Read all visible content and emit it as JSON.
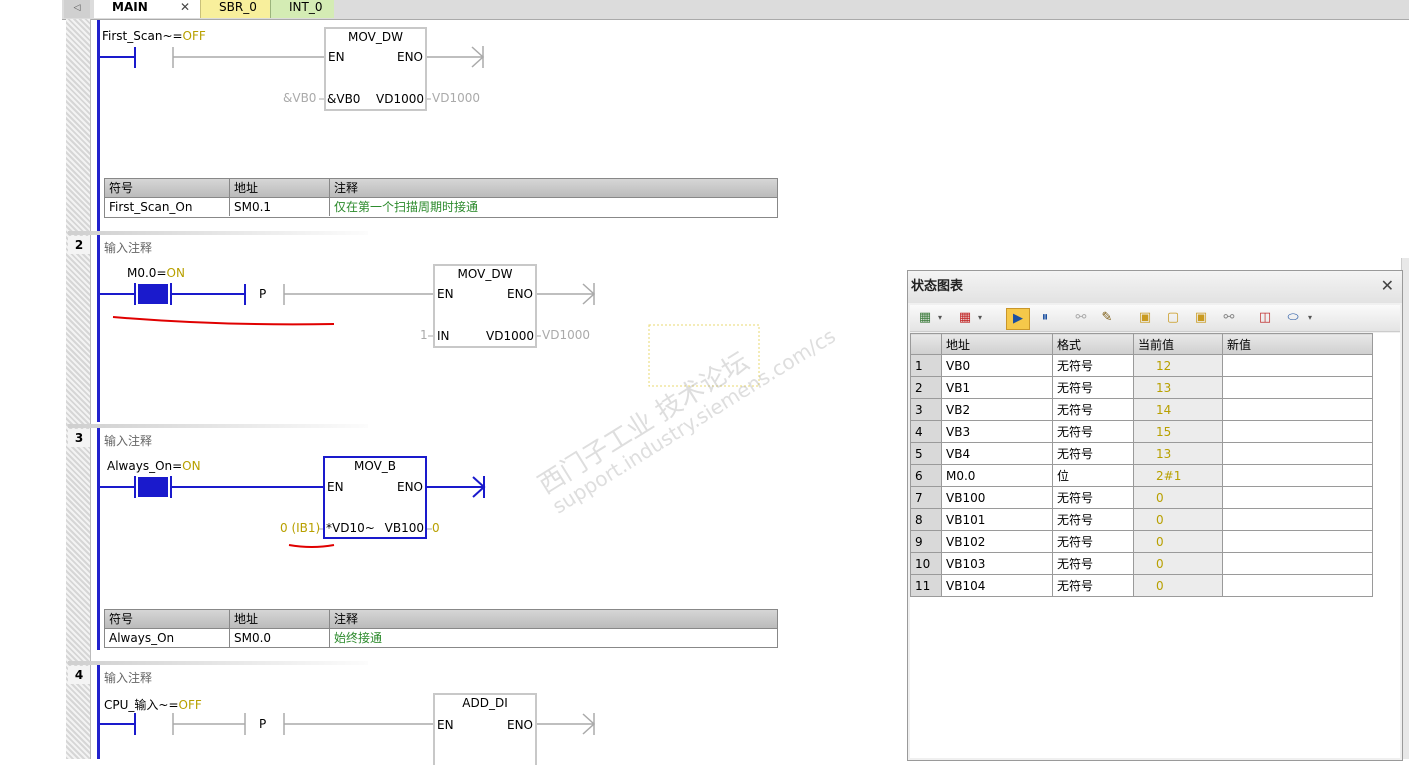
{
  "tabs": [
    "MAIN",
    "SBR_0",
    "INT_0"
  ],
  "tab_close": "✕",
  "nav_arrow": "◁",
  "net1": {
    "contact_label": "First_Scan",
    "contact_suffix": "~=",
    "contact_state": "OFF",
    "block_title": "MOV_DW",
    "en": "EN",
    "eno": "ENO",
    "in_outer": "&VB0",
    "in_inner": "&VB0",
    "out_inner": "VD1000",
    "out_outer": "VD1000",
    "sym_headers": [
      "符号",
      "地址",
      "注释"
    ],
    "sym_row": [
      "First_Scan_On",
      "SM0.1",
      "仅在第一个扫描周期时接通"
    ]
  },
  "net2": {
    "number": "2",
    "comment": "输入注释",
    "contact_label": "M0.0=",
    "contact_state": "ON",
    "p_label": "P",
    "block_title": "MOV_DW",
    "en": "EN",
    "eno": "ENO",
    "in_outer": "1",
    "in_inner": "IN",
    "out_inner": "VD1000",
    "out_outer": "VD1000"
  },
  "net3": {
    "number": "3",
    "comment": "输入注释",
    "contact_label": "Always_On=",
    "contact_state": "ON",
    "block_title": "MOV_B",
    "en": "EN",
    "eno": "ENO",
    "in_outer": "0 (IB1)",
    "in_inner": "*VD10~",
    "out_inner": "VB100",
    "out_outer": "0",
    "sym_headers": [
      "符号",
      "地址",
      "注释"
    ],
    "sym_row": [
      "Always_On",
      "SM0.0",
      "始终接通"
    ]
  },
  "net4": {
    "number": "4",
    "comment": "输入注释",
    "contact_label": "CPU_输入",
    "contact_suffix": "~=",
    "contact_state": "OFF",
    "p_label": "P",
    "block_title": "ADD_DI",
    "en": "EN",
    "eno": "ENO"
  },
  "watermark": {
    "line1": "西门子工业 技术论坛",
    "line2": "support.industry.siemens.com/cs"
  },
  "status_chart": {
    "title": "状态图表",
    "close": "✕",
    "headers": [
      "",
      "地址",
      "格式",
      "当前值",
      "新值"
    ],
    "rows": [
      [
        "1",
        "VB0",
        "无符号",
        "12",
        ""
      ],
      [
        "2",
        "VB1",
        "无符号",
        "13",
        ""
      ],
      [
        "3",
        "VB2",
        "无符号",
        "14",
        ""
      ],
      [
        "4",
        "VB3",
        "无符号",
        "15",
        ""
      ],
      [
        "5",
        "VB4",
        "无符号",
        "13",
        ""
      ],
      [
        "6",
        "M0.0",
        "位",
        "2#1",
        ""
      ],
      [
        "7",
        "VB100",
        "无符号",
        "0",
        ""
      ],
      [
        "8",
        "VB101",
        "无符号",
        "0",
        ""
      ],
      [
        "9",
        "VB102",
        "无符号",
        "0",
        ""
      ],
      [
        "10",
        "VB103",
        "无符号",
        "0",
        ""
      ],
      [
        "11",
        "VB104",
        "无符号",
        "0",
        ""
      ]
    ],
    "toolbar_icons": [
      "insert-row-icon",
      "delete-row-icon",
      "run-status-icon",
      "pause-icon",
      "trend-glasses-icon",
      "write-pencil-icon",
      "lock-icon",
      "unlock-icon",
      "force-icon",
      "read-all-icon",
      "trend-chart-icon",
      "tag-icon"
    ]
  },
  "colors": {
    "rail": "#2222cc",
    "energized": "#1a1acc",
    "value": "#b8a000",
    "comment_green": "#2b8a2b",
    "annotation_red": "#e00000"
  }
}
